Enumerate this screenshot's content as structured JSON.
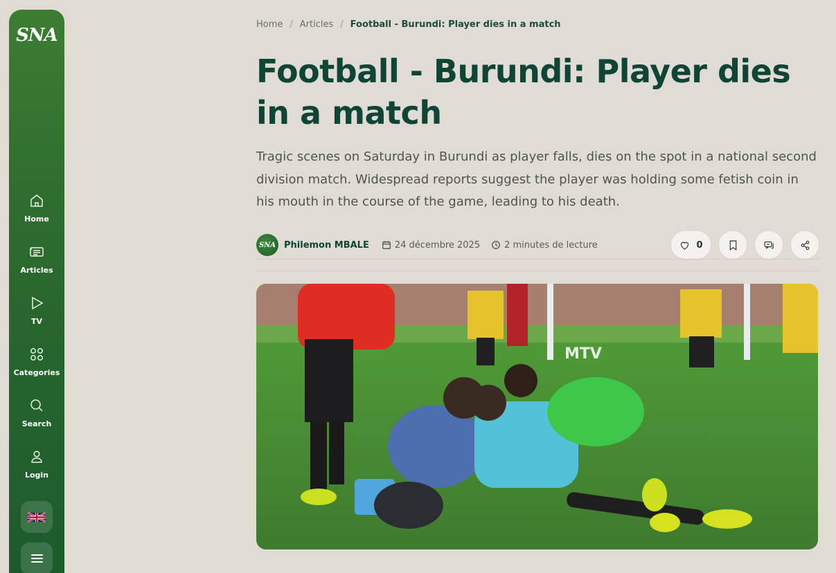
{
  "sidebar": {
    "logo": "SNA",
    "items": [
      {
        "label": "Home",
        "icon": "home-icon"
      },
      {
        "label": "Articles",
        "icon": "articles-icon"
      },
      {
        "label": "TV",
        "icon": "play-icon"
      },
      {
        "label": "Categories",
        "icon": "grid-icon"
      },
      {
        "label": "Search",
        "icon": "search-icon"
      },
      {
        "label": "Login",
        "icon": "user-icon"
      }
    ],
    "language_icon": "uk-flag-icon",
    "menu_icon": "hamburger-icon"
  },
  "breadcrumb": {
    "home": "Home",
    "sep1": "/",
    "articles": "Articles",
    "sep2": "/",
    "current": "Football - Burundi: Player dies in a match"
  },
  "article": {
    "title": "Football - Burundi: Player dies in a match",
    "lead": "Tragic scenes on Saturday in Burundi as player falls, dies on the spot in a national second division match. Widespread reports suggest the player was holding some fetish coin in his mouth in the course of the game, leading to his death.",
    "author": "Philemon MBALE",
    "author_avatar_text": "SNA",
    "date": "24 décembre 2025",
    "read_time": "2 minutes de lecture",
    "likes": "0",
    "image_watermark": "MTV"
  },
  "colors": {
    "sidebar_green": "#2c6a2f",
    "title_green": "#0e4537",
    "page_bg": "#e0dbd3"
  }
}
